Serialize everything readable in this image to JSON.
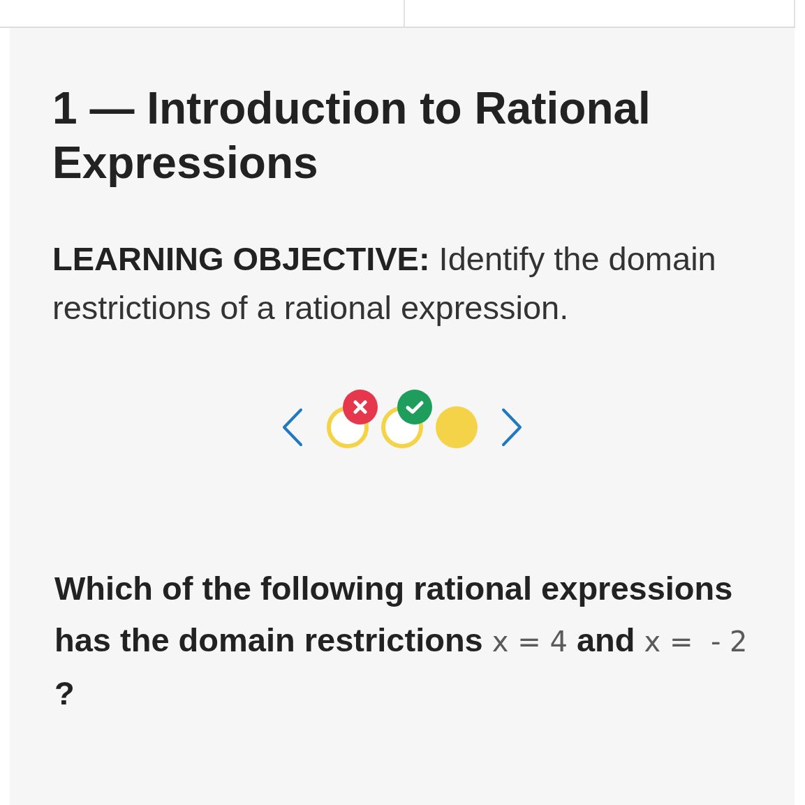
{
  "lesson": {
    "title": "1 — Introduction to Rational Expressions",
    "objective": "**LEARNING OBJECTIVE:** Identify the domain restrictions of a rational expression."
  },
  "progress": {
    "items": [
      {
        "kind": "incorrect",
        "selected": false
      },
      {
        "kind": "correct",
        "selected": false
      },
      {
        "kind": "pending",
        "selected": true
      }
    ]
  },
  "question": {
    "parts": [
      {
        "kind": "text",
        "text": "Which of the following rational expressions has the domain restrictions "
      },
      {
        "kind": "math",
        "text": "x = 4"
      },
      {
        "kind": "text",
        "text": " and "
      },
      {
        "kind": "math",
        "text": "x =  - 2"
      },
      {
        "kind": "text",
        "text": " ?"
      }
    ]
  }
}
